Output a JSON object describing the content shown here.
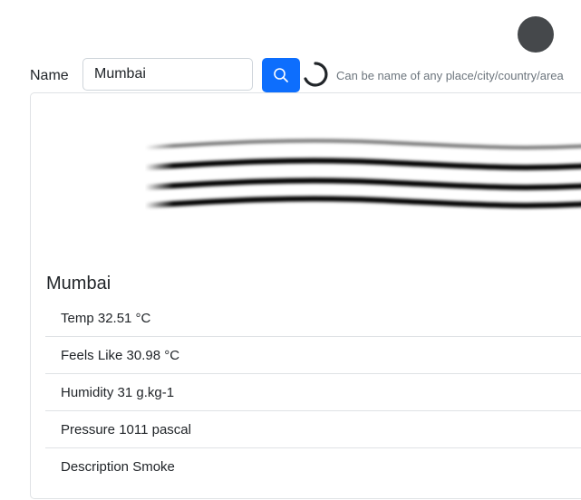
{
  "form": {
    "name_label": "Name",
    "name_value": "Mumbai",
    "hint": "Can be name of any place/city/country/area"
  },
  "icons": {
    "search": "search-icon",
    "spinner": "loading-spinner-icon",
    "weather": "smoke-weather-icon",
    "avatar": "avatar"
  },
  "colors": {
    "primary": "#0d6efd",
    "avatar": "#45484b",
    "border": "#dfe2e5"
  },
  "result": {
    "city": "Mumbai",
    "items": [
      "Temp 32.51 °C",
      "Feels Like 30.98 °C",
      "Humidity 31 g.kg-1",
      "Pressure 1011 pascal",
      "Description Smoke"
    ]
  }
}
